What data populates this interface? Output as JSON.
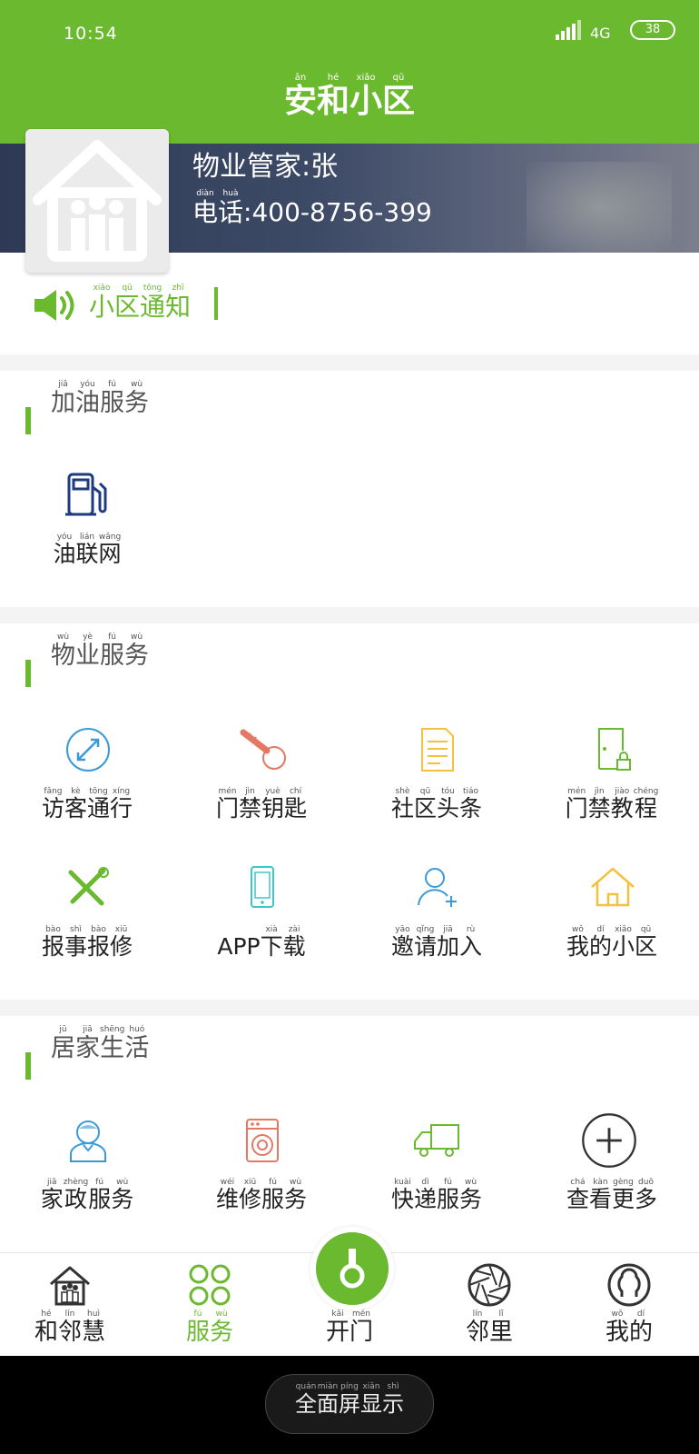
{
  "status": {
    "time": "10:54",
    "network": "4G",
    "battery": "38"
  },
  "header": {
    "title": [
      [
        "安",
        "ān"
      ],
      [
        "和",
        "hé"
      ],
      [
        "小",
        "xiǎo"
      ],
      [
        "区",
        "qū"
      ]
    ]
  },
  "banner": {
    "manager": "物业管家:张",
    "phone_prefix": [
      [
        "电",
        "diàn"
      ],
      [
        "话",
        "huà"
      ]
    ],
    "phone_number": ":400-8756-399"
  },
  "notice": {
    "label": [
      [
        "小",
        "xiǎo"
      ],
      [
        "区",
        "qū"
      ],
      [
        "通",
        "tōng"
      ],
      [
        "知",
        "zhī"
      ]
    ]
  },
  "sections": [
    {
      "title": [
        [
          "加",
          "jiā"
        ],
        [
          "油",
          "yóu"
        ],
        [
          "服",
          "fú"
        ],
        [
          "务",
          "wù"
        ]
      ],
      "items": [
        {
          "icon": "gas-pump-icon",
          "label": [
            [
              "油",
              "yóu"
            ],
            [
              "联",
              "lián"
            ],
            [
              "网",
              "wǎng"
            ]
          ]
        }
      ]
    },
    {
      "title": [
        [
          "物",
          "wù"
        ],
        [
          "业",
          "yè"
        ],
        [
          "服",
          "fú"
        ],
        [
          "务",
          "wù"
        ]
      ],
      "items": [
        {
          "icon": "visitor-pass-icon",
          "label": [
            [
              "访",
              "fǎng"
            ],
            [
              "客",
              "kè"
            ],
            [
              "通",
              "tōng"
            ],
            [
              "行",
              "xíng"
            ]
          ]
        },
        {
          "icon": "key-icon",
          "label": [
            [
              "门",
              "mén"
            ],
            [
              "禁",
              "jìn"
            ],
            [
              "钥",
              "yuè"
            ],
            [
              "匙",
              "chí"
            ]
          ]
        },
        {
          "icon": "news-icon",
          "label": [
            [
              "社",
              "shè"
            ],
            [
              "区",
              "qū"
            ],
            [
              "头",
              "tóu"
            ],
            [
              "条",
              "tiáo"
            ]
          ]
        },
        {
          "icon": "door-lock-icon",
          "label": [
            [
              "门",
              "mén"
            ],
            [
              "禁",
              "jìn"
            ],
            [
              "教",
              "jiào"
            ],
            [
              "程",
              "chéng"
            ]
          ]
        },
        {
          "icon": "repair-tools-icon",
          "label": [
            [
              "报",
              "bào"
            ],
            [
              "事",
              "shì"
            ],
            [
              "报",
              "bào"
            ],
            [
              "修",
              "xiū"
            ]
          ]
        },
        {
          "icon": "phone-download-icon",
          "label": [
            [
              "APP",
              ""
            ],
            [
              "下",
              "xià"
            ],
            [
              "载",
              "zài"
            ]
          ]
        },
        {
          "icon": "invite-user-icon",
          "label": [
            [
              "邀",
              "yāo"
            ],
            [
              "请",
              "qǐng"
            ],
            [
              "加",
              "jiā"
            ],
            [
              "入",
              "rù"
            ]
          ]
        },
        {
          "icon": "my-home-icon",
          "label": [
            [
              "我",
              "wǒ"
            ],
            [
              "的",
              "dí"
            ],
            [
              "小",
              "xiǎo"
            ],
            [
              "区",
              "qū"
            ]
          ]
        }
      ]
    },
    {
      "title": [
        [
          "居",
          "jū"
        ],
        [
          "家",
          "jiā"
        ],
        [
          "生",
          "shēng"
        ],
        [
          "活",
          "huó"
        ]
      ],
      "items": [
        {
          "icon": "housekeeper-icon",
          "label": [
            [
              "家",
              "jiā"
            ],
            [
              "政",
              "zhèng"
            ],
            [
              "服",
              "fú"
            ],
            [
              "务",
              "wù"
            ]
          ]
        },
        {
          "icon": "washing-machine-icon",
          "label": [
            [
              "维",
              "wéi"
            ],
            [
              "修",
              "xiū"
            ],
            [
              "服",
              "fú"
            ],
            [
              "务",
              "wù"
            ]
          ]
        },
        {
          "icon": "delivery-truck-icon",
          "label": [
            [
              "快",
              "kuài"
            ],
            [
              "递",
              "dì"
            ],
            [
              "服",
              "fú"
            ],
            [
              "务",
              "wù"
            ]
          ]
        },
        {
          "icon": "plus-circle-icon",
          "label": [
            [
              "查",
              "chá"
            ],
            [
              "看",
              "kàn"
            ],
            [
              "更",
              "gèng"
            ],
            [
              "多",
              "duō"
            ]
          ]
        }
      ]
    }
  ],
  "bottom_nav": [
    {
      "icon": "family-home-icon",
      "label": [
        [
          "和",
          "hé"
        ],
        [
          "邻",
          "lín"
        ],
        [
          "慧",
          "huì"
        ]
      ],
      "active": false
    },
    {
      "icon": "clover-grid-icon",
      "label": [
        [
          "服",
          "fú"
        ],
        [
          "务",
          "wù"
        ]
      ],
      "active": true
    },
    {
      "icon": "door-key-icon",
      "label": [
        [
          "开",
          "kāi"
        ],
        [
          "门",
          "mén"
        ]
      ],
      "active": false
    },
    {
      "icon": "aperture-icon",
      "label": [
        [
          "邻",
          "lín"
        ],
        [
          "里",
          "lǐ"
        ]
      ],
      "active": false
    },
    {
      "icon": "user-icon",
      "label": [
        [
          "我",
          "wǒ"
        ],
        [
          "的",
          "dí"
        ]
      ],
      "active": false
    }
  ],
  "fullscreen": {
    "label": [
      [
        "全",
        "quán"
      ],
      [
        "面",
        "miàn"
      ],
      [
        "屏",
        "píng"
      ],
      [
        "显",
        "xiǎn"
      ],
      [
        "示",
        "shì"
      ]
    ]
  },
  "colors": {
    "brand": "#6bb92f",
    "blue": "#3a9ad9",
    "red": "#e47862",
    "yellow": "#f2c13d",
    "green": "#6bb92f",
    "navy": "#1e3a80"
  }
}
